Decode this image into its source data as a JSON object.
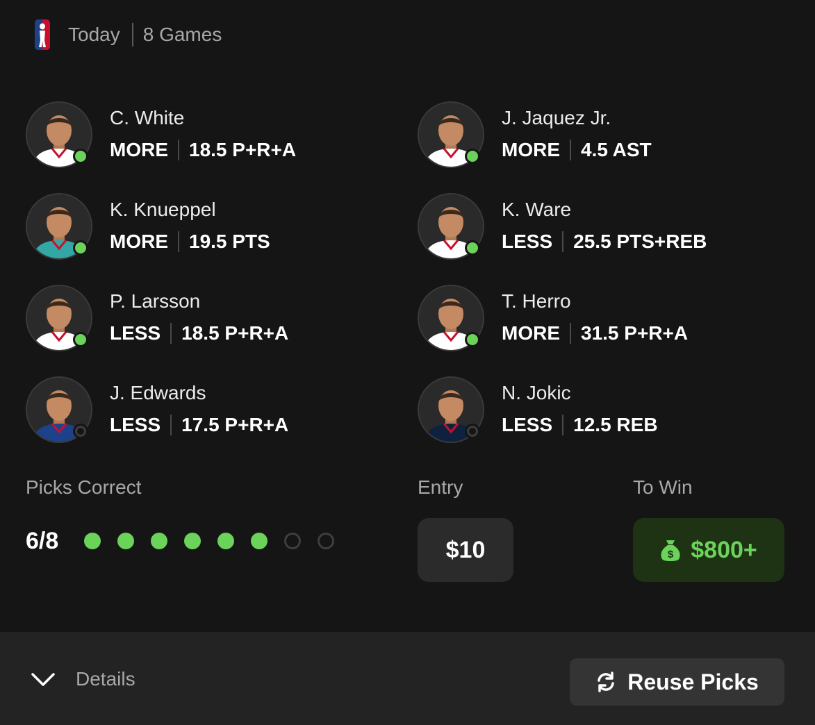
{
  "header": {
    "logo_icon": "nba-logo-icon",
    "day": "Today",
    "games": "8 Games"
  },
  "picks": [
    {
      "player": "C. White",
      "direction": "MORE",
      "line": "18.5 P+R+A",
      "status": "correct",
      "jersey_color": "#ffffff"
    },
    {
      "player": "J. Jaquez Jr.",
      "direction": "MORE",
      "line": "4.5 AST",
      "status": "correct",
      "jersey_color": "#ffffff"
    },
    {
      "player": "K. Knueppel",
      "direction": "MORE",
      "line": "19.5 PTS",
      "status": "correct",
      "jersey_color": "#33a7a6"
    },
    {
      "player": "K. Ware",
      "direction": "LESS",
      "line": "25.5 PTS+REB",
      "status": "correct",
      "jersey_color": "#ffffff"
    },
    {
      "player": "P. Larsson",
      "direction": "LESS",
      "line": "18.5 P+R+A",
      "status": "correct",
      "jersey_color": "#ffffff"
    },
    {
      "player": "T. Herro",
      "direction": "MORE",
      "line": "31.5 P+R+A",
      "status": "correct",
      "jersey_color": "#ffffff"
    },
    {
      "player": "J. Edwards",
      "direction": "LESS",
      "line": "17.5 P+R+A",
      "status": "pending",
      "jersey_color": "#1d428a"
    },
    {
      "player": "N. Jokic",
      "direction": "LESS",
      "line": "12.5 REB",
      "status": "pending",
      "jersey_color": "#0e2240"
    }
  ],
  "summary": {
    "picks_correct_label": "Picks Correct",
    "picks_correct_value": "6/8",
    "correct_count": 6,
    "total_count": 8,
    "entry_label": "Entry",
    "entry_value": "$10",
    "to_win_label": "To Win",
    "to_win_value": "$800+",
    "to_win_icon": "money-bag-icon"
  },
  "footer": {
    "details_label": "Details",
    "details_icon": "chevron-down-icon",
    "reuse_label": "Reuse Picks",
    "reuse_icon": "refresh-icon"
  },
  "colors": {
    "background": "#151515",
    "footer": "#232323",
    "accent_green": "#6bd25a",
    "win_bg": "#1d3314",
    "muted_text": "#a8a8a8"
  }
}
